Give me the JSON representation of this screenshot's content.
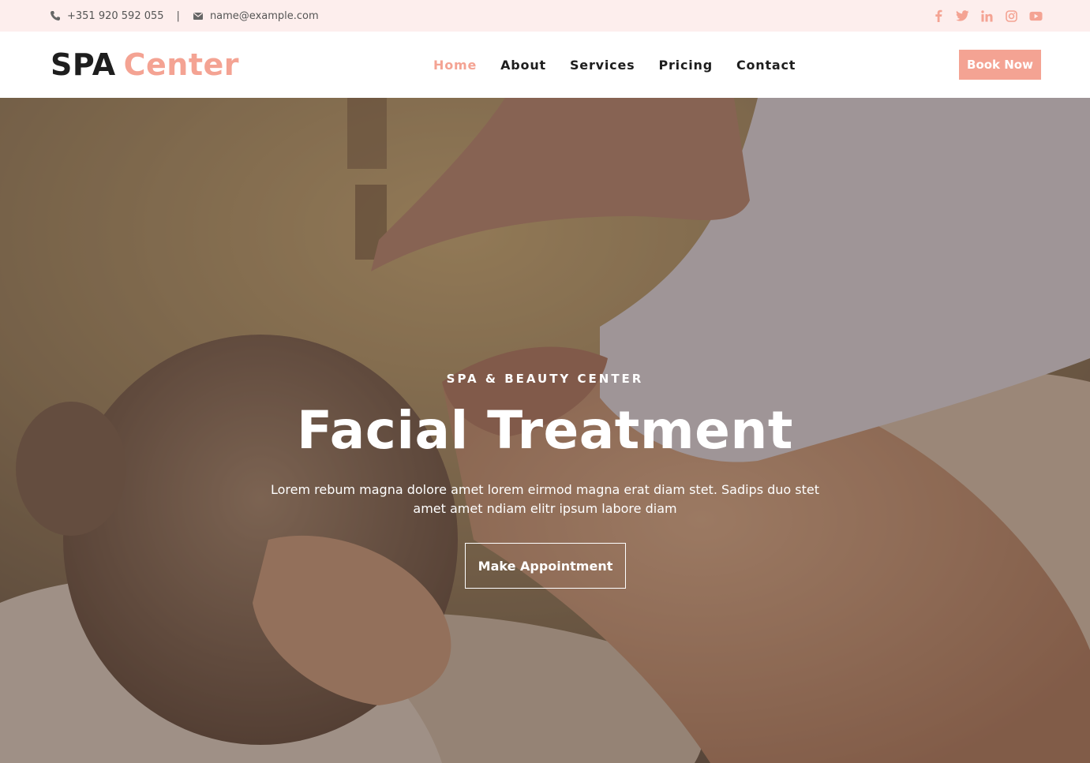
{
  "topbar": {
    "phone": "+351 920 592 055",
    "separator": "|",
    "email": "name@example.com",
    "icons": [
      "phone-icon",
      "envelope-icon"
    ],
    "social": [
      "facebook-icon",
      "twitter-icon",
      "linkedin-icon",
      "instagram-icon",
      "youtube-icon"
    ]
  },
  "brand": {
    "part1": "SPA",
    "part2": "Center"
  },
  "nav": {
    "items": [
      {
        "label": "Home",
        "active": true
      },
      {
        "label": "About"
      },
      {
        "label": "Services"
      },
      {
        "label": "Pricing"
      },
      {
        "label": "Contact"
      }
    ],
    "cta": "Book Now"
  },
  "hero": {
    "eyebrow": "SPA & BEAUTY CENTER",
    "title": "Facial Treatment",
    "description": "Lorem rebum magna dolore amet lorem eirmod magna erat diam stet. Sadips duo stet amet amet ndiam elitr ipsum labore diam",
    "button": "Make Appointment"
  },
  "colors": {
    "accent": "#f4a393",
    "dark": "#1e1e1e",
    "topbar_bg": "#fdeeed"
  }
}
